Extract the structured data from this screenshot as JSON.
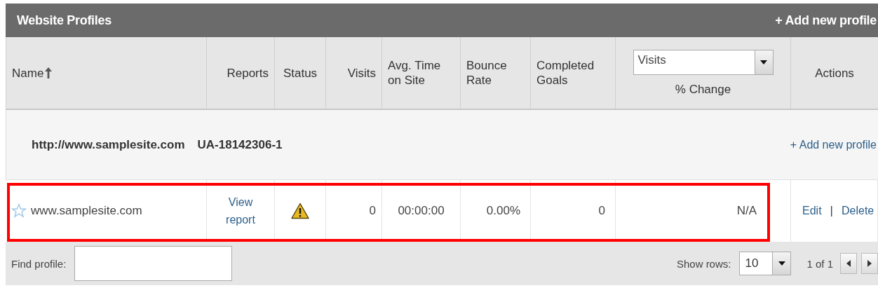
{
  "panel": {
    "title": "Website Profiles",
    "add_link": "+ Add new profile"
  },
  "columns": [
    {
      "kind": "text",
      "label": "Name",
      "sorted": true
    },
    {
      "kind": "text",
      "label": "Reports",
      "sorted": false
    },
    {
      "kind": "text",
      "label": "Status",
      "sorted": false
    },
    {
      "kind": "text",
      "label": "Visits",
      "sorted": false
    },
    {
      "kind": "text",
      "label": "Avg. Time on Site",
      "sorted": false
    },
    {
      "kind": "text",
      "label": "Bounce Rate",
      "sorted": false
    },
    {
      "kind": "text",
      "label": "Completed Goals",
      "sorted": false
    },
    {
      "kind": "select",
      "value": "Visits",
      "label": "% Change",
      "sorted": false
    },
    {
      "kind": "text",
      "label": "Actions",
      "sorted": false
    }
  ],
  "account": {
    "url": "http://www.samplesite.com",
    "tracking_id": "UA-18142306-1",
    "add_link": "+ Add new profile"
  },
  "profiles": [
    {
      "starred": false,
      "name": "www.samplesite.com",
      "report_link": "View report",
      "warning": true,
      "visits": "0",
      "avg_time": "00:00:00",
      "bounce_rate": "0.00%",
      "goals": "0",
      "change": "N/A",
      "actions": [
        "Edit",
        "Delete"
      ],
      "separator": "|",
      "highlighted": true
    }
  ],
  "footer": {
    "find_label": "Find profile:",
    "show_rows_label": "Show rows:",
    "rows_value": "10",
    "page": "1 of 1"
  }
}
